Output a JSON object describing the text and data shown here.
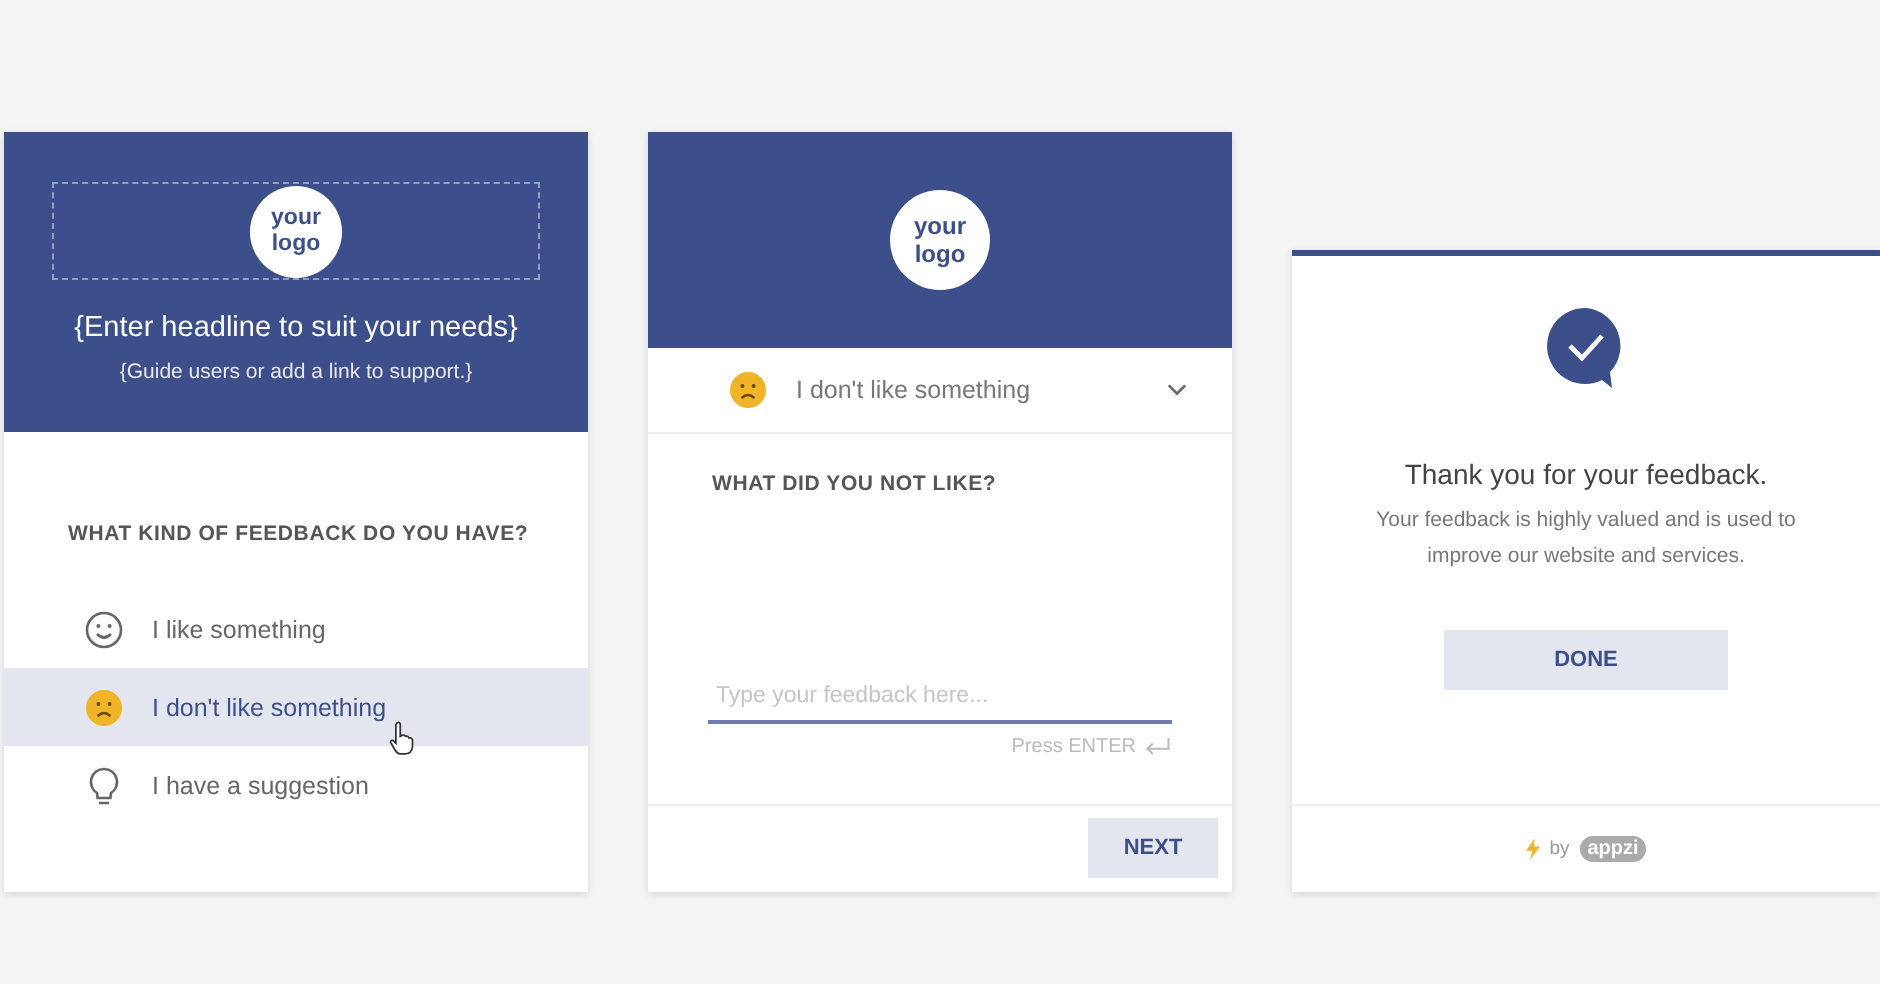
{
  "intro_panel": {
    "logo": [
      "your",
      "logo"
    ],
    "headline": "{Enter headline to suit your needs}",
    "subheadline": "{Guide users or add a link to support.}",
    "question": "WHAT KIND OF FEEDBACK DO YOU HAVE?",
    "options": [
      {
        "kind": "smile",
        "label": "I like something",
        "selected": false
      },
      {
        "kind": "frown",
        "label": "I don't like something",
        "selected": true
      },
      {
        "kind": "bulb",
        "label": "I have a suggestion",
        "selected": false
      }
    ]
  },
  "detail_panel": {
    "logo": [
      "your",
      "logo"
    ],
    "dropdown": {
      "kind": "frown",
      "label": "I don't like something"
    },
    "question": "WHAT DID YOU NOT LIKE?",
    "input": {
      "placeholder": "Type your feedback here..."
    },
    "hint": "Press ENTER",
    "button": "NEXT"
  },
  "thanks_panel": {
    "title": "Thank you for your feedback.",
    "message": "Your feedback is highly valued and is used to improve our website and services.",
    "button": "DONE",
    "by": "by",
    "brand": "appzi"
  }
}
